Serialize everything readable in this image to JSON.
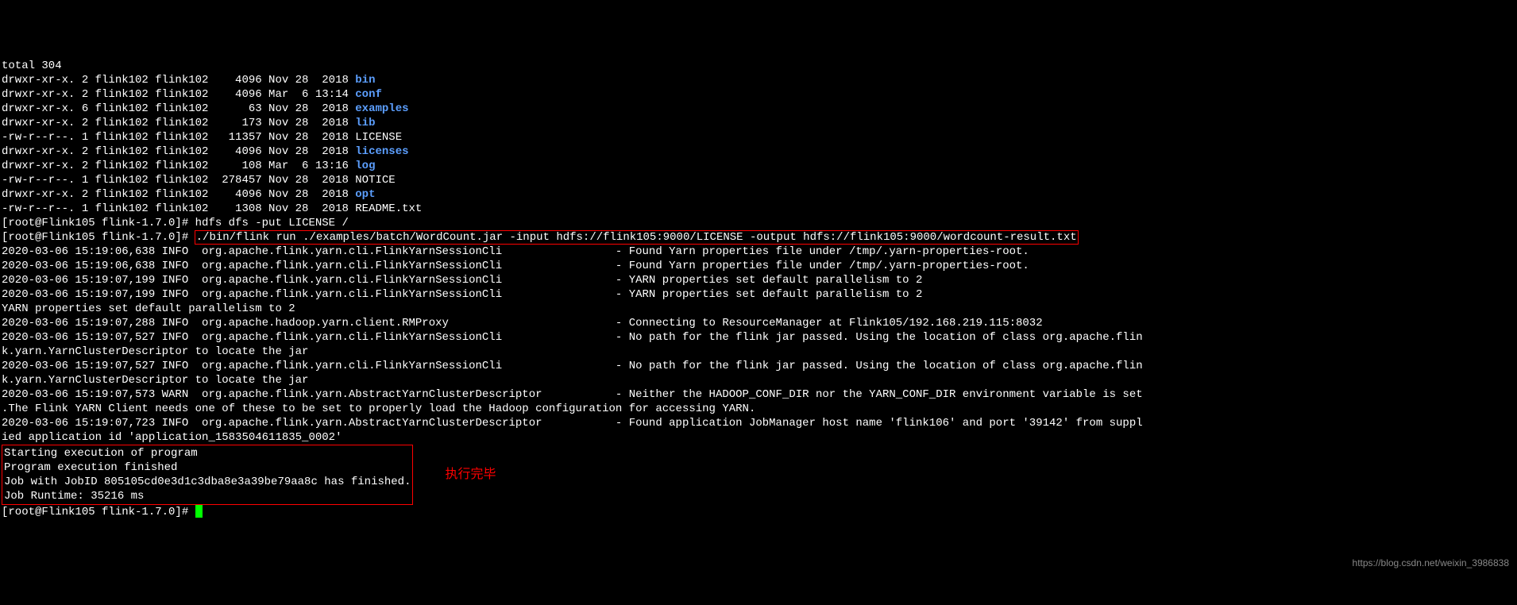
{
  "total": "total 304",
  "ls": [
    {
      "perm": "drwxr-xr-x.",
      "links": "2",
      "owner": "flink102",
      "group": "flink102",
      "size": "   4096",
      "date": "Nov 28  2018",
      "name": "bin",
      "dir": true
    },
    {
      "perm": "drwxr-xr-x.",
      "links": "2",
      "owner": "flink102",
      "group": "flink102",
      "size": "   4096",
      "date": "Mar  6 13:14",
      "name": "conf",
      "dir": true
    },
    {
      "perm": "drwxr-xr-x.",
      "links": "6",
      "owner": "flink102",
      "group": "flink102",
      "size": "     63",
      "date": "Nov 28  2018",
      "name": "examples",
      "dir": true
    },
    {
      "perm": "drwxr-xr-x.",
      "links": "2",
      "owner": "flink102",
      "group": "flink102",
      "size": "    173",
      "date": "Nov 28  2018",
      "name": "lib",
      "dir": true
    },
    {
      "perm": "-rw-r--r--.",
      "links": "1",
      "owner": "flink102",
      "group": "flink102",
      "size": "  11357",
      "date": "Nov 28  2018",
      "name": "LICENSE",
      "dir": false
    },
    {
      "perm": "drwxr-xr-x.",
      "links": "2",
      "owner": "flink102",
      "group": "flink102",
      "size": "   4096",
      "date": "Nov 28  2018",
      "name": "licenses",
      "dir": true
    },
    {
      "perm": "drwxr-xr-x.",
      "links": "2",
      "owner": "flink102",
      "group": "flink102",
      "size": "    108",
      "date": "Mar  6 13:16",
      "name": "log",
      "dir": true
    },
    {
      "perm": "-rw-r--r--.",
      "links": "1",
      "owner": "flink102",
      "group": "flink102",
      "size": " 278457",
      "date": "Nov 28  2018",
      "name": "NOTICE",
      "dir": false
    },
    {
      "perm": "drwxr-xr-x.",
      "links": "2",
      "owner": "flink102",
      "group": "flink102",
      "size": "   4096",
      "date": "Nov 28  2018",
      "name": "opt",
      "dir": true
    },
    {
      "perm": "-rw-r--r--.",
      "links": "1",
      "owner": "flink102",
      "group": "flink102",
      "size": "   1308",
      "date": "Nov 28  2018",
      "name": "README.txt",
      "dir": false
    }
  ],
  "prompt1": "[root@Flink105 flink-1.7.0]# ",
  "cmd1": "hdfs dfs -put LICENSE /",
  "prompt2": "[root@Flink105 flink-1.7.0]# ",
  "cmd2": "./bin/flink run ./examples/batch/WordCount.jar -input hdfs://flink105:9000/LICENSE -output hdfs://flink105:9000/wordcount-result.txt",
  "logs": [
    "2020-03-06 15:19:06,638 INFO  org.apache.flink.yarn.cli.FlinkYarnSessionCli                 - Found Yarn properties file under /tmp/.yarn-properties-root.",
    "2020-03-06 15:19:06,638 INFO  org.apache.flink.yarn.cli.FlinkYarnSessionCli                 - Found Yarn properties file under /tmp/.yarn-properties-root.",
    "2020-03-06 15:19:07,199 INFO  org.apache.flink.yarn.cli.FlinkYarnSessionCli                 - YARN properties set default parallelism to 2",
    "2020-03-06 15:19:07,199 INFO  org.apache.flink.yarn.cli.FlinkYarnSessionCli                 - YARN properties set default parallelism to 2",
    "YARN properties set default parallelism to 2",
    "2020-03-06 15:19:07,288 INFO  org.apache.hadoop.yarn.client.RMProxy                         - Connecting to ResourceManager at Flink105/192.168.219.115:8032",
    "2020-03-06 15:19:07,527 INFO  org.apache.flink.yarn.cli.FlinkYarnSessionCli                 - No path for the flink jar passed. Using the location of class org.apache.flin",
    "k.yarn.YarnClusterDescriptor to locate the jar",
    "2020-03-06 15:19:07,527 INFO  org.apache.flink.yarn.cli.FlinkYarnSessionCli                 - No path for the flink jar passed. Using the location of class org.apache.flin",
    "k.yarn.YarnClusterDescriptor to locate the jar",
    "2020-03-06 15:19:07,573 WARN  org.apache.flink.yarn.AbstractYarnClusterDescriptor           - Neither the HADOOP_CONF_DIR nor the YARN_CONF_DIR environment variable is set",
    ".The Flink YARN Client needs one of these to be set to properly load the Hadoop configuration for accessing YARN.",
    "2020-03-06 15:19:07,723 INFO  org.apache.flink.yarn.AbstractYarnClusterDescriptor           - Found application JobManager host name 'flink106' and port '39142' from suppl",
    "ied application id 'application_1583504611835_0002'"
  ],
  "result": [
    "Starting execution of program",
    "Program execution finished",
    "Job with JobID 805105cd0e3d1c3dba8e3a39be79aa8c has finished.",
    "Job Runtime: 35216 ms"
  ],
  "annotation": "执行完毕",
  "prompt3": "[root@Flink105 flink-1.7.0]# ",
  "watermark": "https://blog.csdn.net/weixin_3986838"
}
